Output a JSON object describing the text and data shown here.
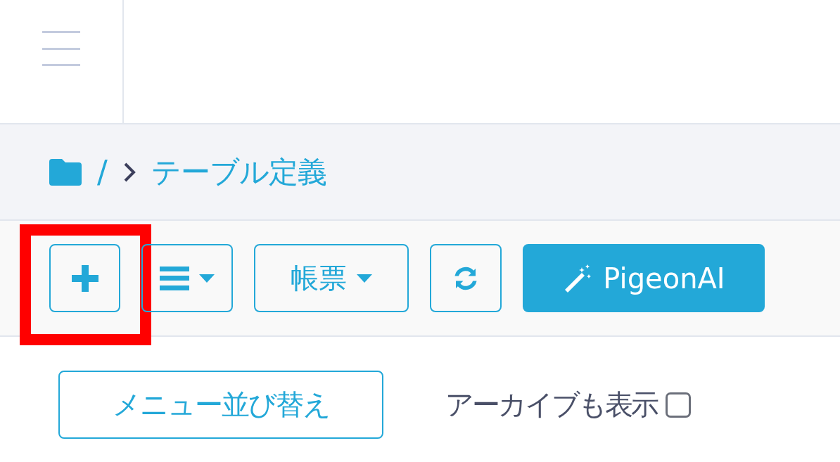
{
  "breadcrumb": {
    "separator": "/",
    "current": "テーブル定義"
  },
  "toolbar": [
    {
      "kind": "add",
      "highlighted": true
    },
    {
      "kind": "menu",
      "highlighted": false
    },
    {
      "kind": "dropdown",
      "label": "帳票",
      "highlighted": false
    },
    {
      "kind": "refresh",
      "highlighted": false
    },
    {
      "kind": "ai",
      "label": "PigeonAI",
      "highlighted": false
    }
  ],
  "actions": {
    "sort_button": "メニュー並び替え",
    "archive": {
      "label": "アーカイブも表示",
      "checked": false
    }
  }
}
